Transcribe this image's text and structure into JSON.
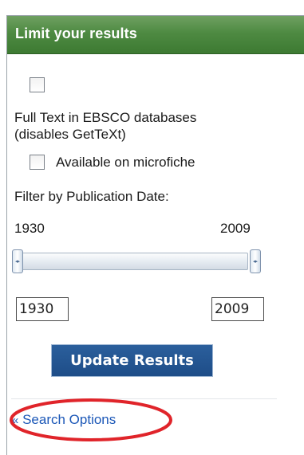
{
  "panel": {
    "title": "Limit your results"
  },
  "limiters": [
    {
      "label_line1": "Full Text in EBSCO databases",
      "label_line2": "(disables GetTeXt)",
      "checked": false
    },
    {
      "label": "Available on microfiche",
      "checked": false
    }
  ],
  "date_filter": {
    "label": "Filter by Publication Date:",
    "range_min_label": "1930",
    "range_max_label": "2009",
    "from_value": "1930",
    "to_value": "2009"
  },
  "buttons": {
    "update": "Update Results"
  },
  "links": {
    "search_options_arrow": "«",
    "search_options": "Search Options"
  },
  "colors": {
    "header_green": "#4e8a42",
    "button_blue": "#1e4d88",
    "link_blue": "#1b57b7",
    "highlight_red": "#e0242a"
  },
  "icons": {
    "slider_grip": "double-arrow-grip-icon",
    "link_arrow": "double-chevron-left-icon"
  }
}
